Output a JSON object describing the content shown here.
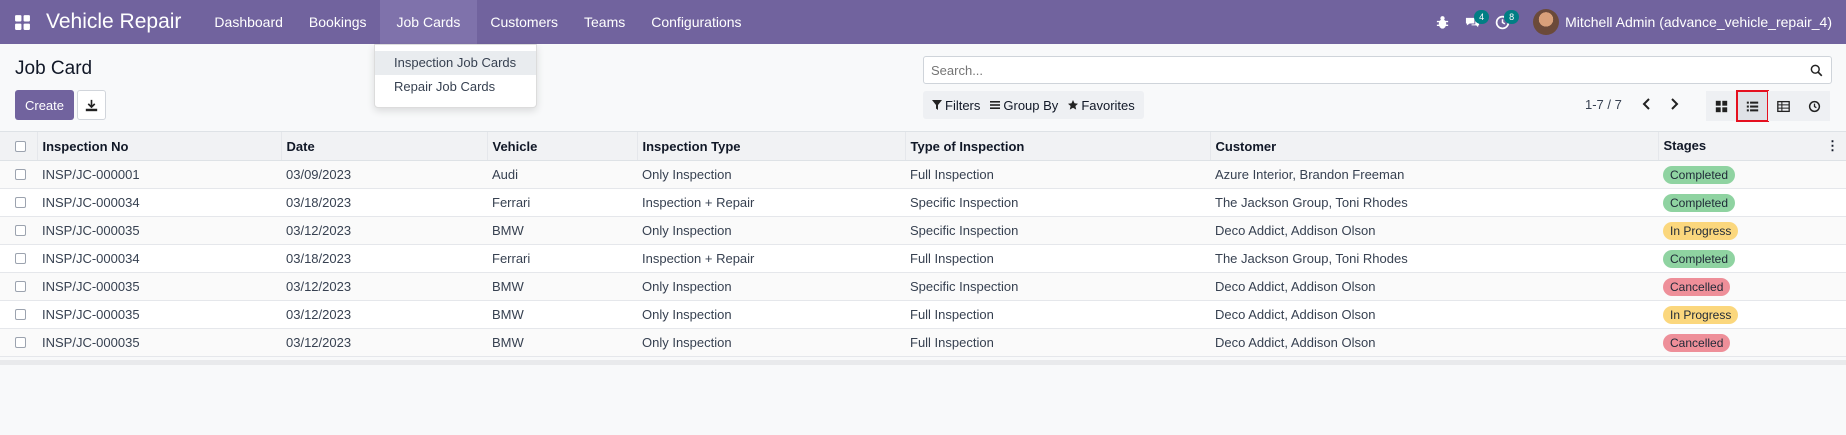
{
  "navbar": {
    "app_name": "Vehicle Repair",
    "menu": [
      "Dashboard",
      "Bookings",
      "Job Cards",
      "Customers",
      "Teams",
      "Configurations"
    ],
    "messages_count": "4",
    "activities_count": "8",
    "user_name": "Mitchell Admin (advance_vehicle_repair_4)",
    "color": "#71639e"
  },
  "dropdown": {
    "items": [
      "Inspection Job Cards",
      "Repair Job Cards"
    ]
  },
  "control": {
    "title": "Job Card",
    "create_label": "Create",
    "search_placeholder": "Search...",
    "filters_label": "Filters",
    "groupby_label": "Group By",
    "favorites_label": "Favorites",
    "pager": "1-7 / 7"
  },
  "table": {
    "headers": [
      "Inspection No",
      "Date",
      "Vehicle",
      "Inspection Type",
      "Type of Inspection",
      "Customer",
      "Stages"
    ],
    "rows": [
      [
        "INSP/JC-000001",
        "03/09/2023",
        "Audi",
        "Only Inspection",
        "Full Inspection",
        "Azure Interior, Brandon Freeman",
        "Completed"
      ],
      [
        "INSP/JC-000034",
        "03/18/2023",
        "Ferrari",
        "Inspection + Repair",
        "Specific Inspection",
        "The Jackson Group, Toni Rhodes",
        "Completed"
      ],
      [
        "INSP/JC-000035",
        "03/12/2023",
        "BMW",
        "Only Inspection",
        "Specific Inspection",
        "Deco Addict, Addison Olson",
        "In Progress"
      ],
      [
        "INSP/JC-000034",
        "03/18/2023",
        "Ferrari",
        "Inspection + Repair",
        "Full Inspection",
        "The Jackson Group, Toni Rhodes",
        "Completed"
      ],
      [
        "INSP/JC-000035",
        "03/12/2023",
        "BMW",
        "Only Inspection",
        "Specific Inspection",
        "Deco Addict, Addison Olson",
        "Cancelled"
      ],
      [
        "INSP/JC-000035",
        "03/12/2023",
        "BMW",
        "Only Inspection",
        "Full Inspection",
        "Deco Addict, Addison Olson",
        "In Progress"
      ],
      [
        "INSP/JC-000035",
        "03/12/2023",
        "BMW",
        "Only Inspection",
        "Full Inspection",
        "Deco Addict, Addison Olson",
        "Cancelled"
      ]
    ],
    "stage_colors": {
      "Completed": "#8fd3a1",
      "In Progress": "#fbd77d",
      "Cancelled": "#ee8f99"
    }
  }
}
